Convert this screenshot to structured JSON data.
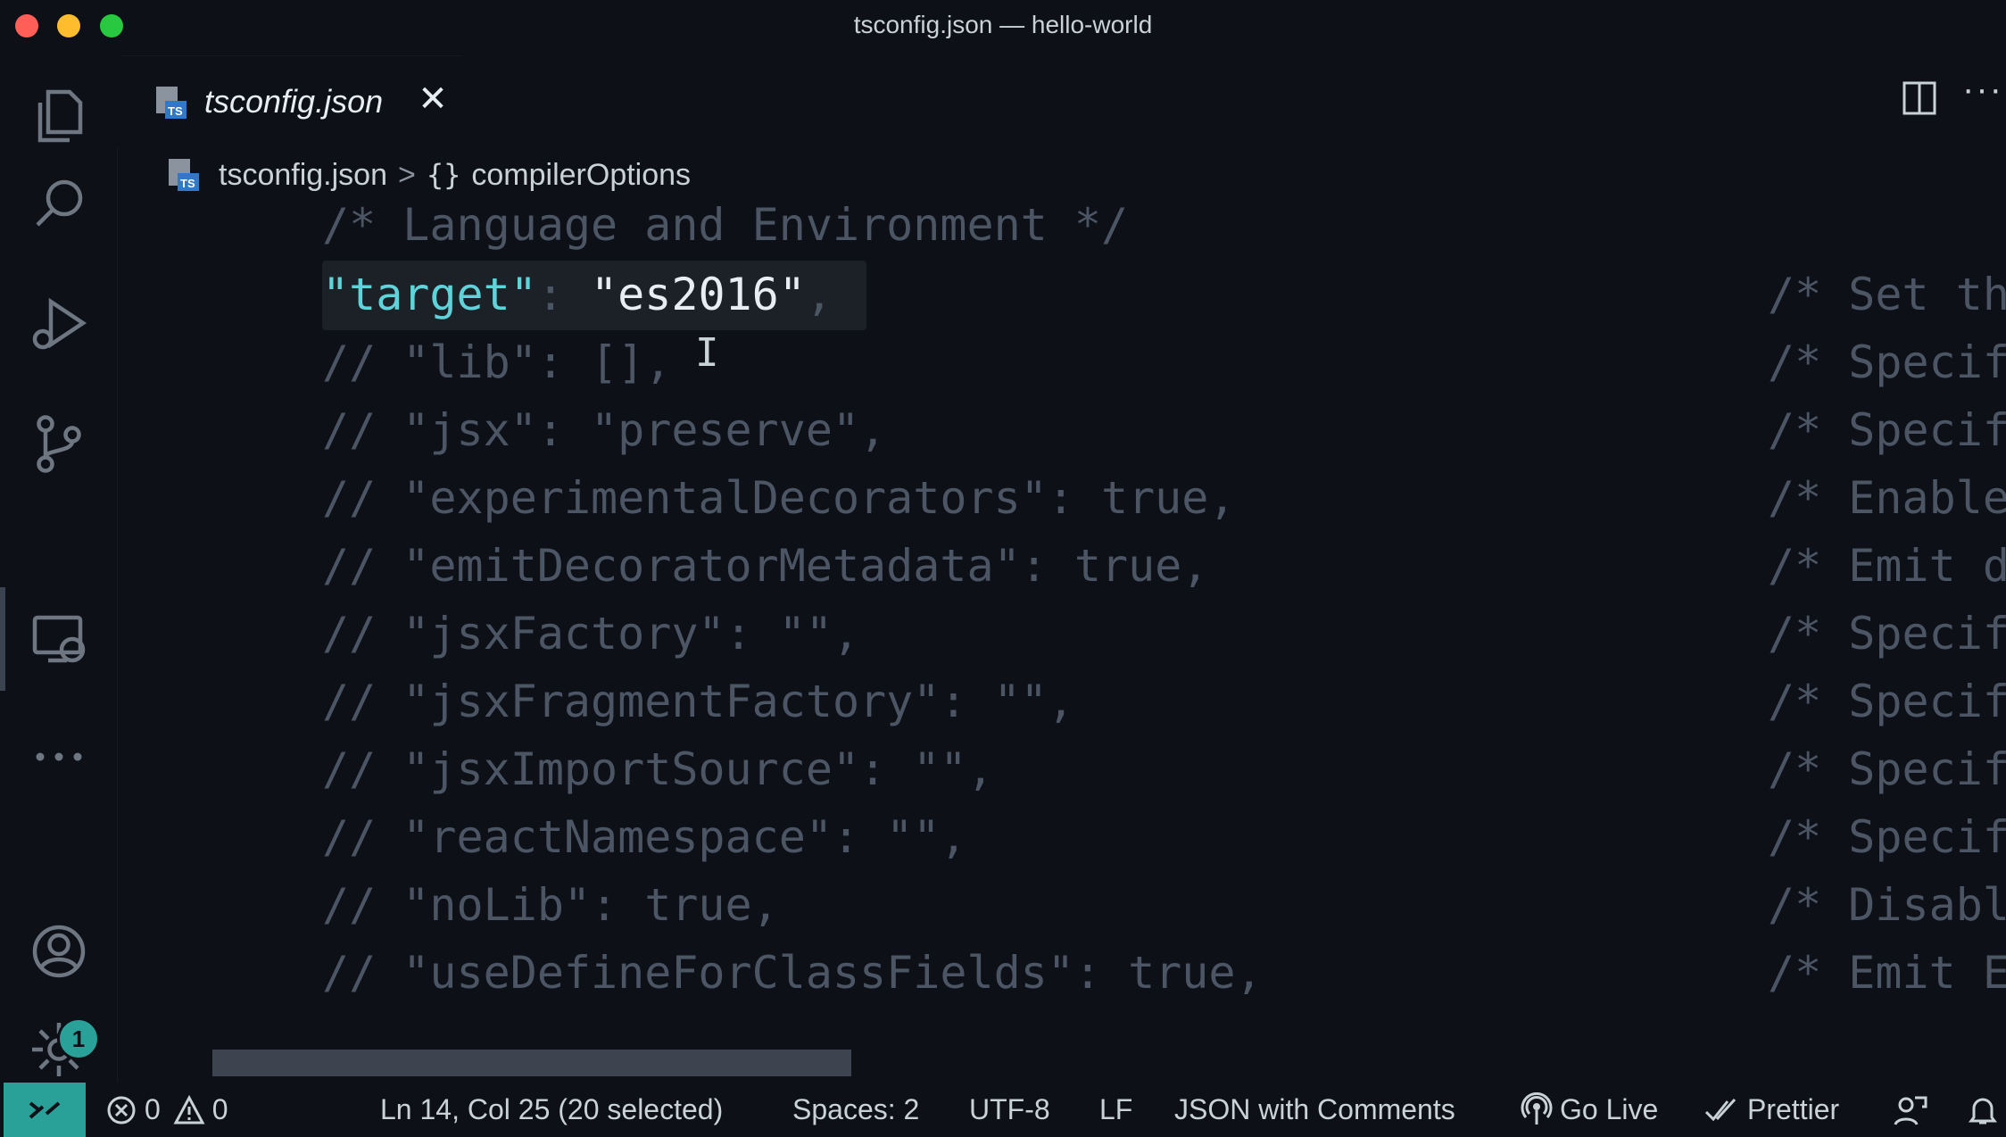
{
  "window": {
    "title": "tsconfig.json — hello-world"
  },
  "tab": {
    "label": "tsconfig.json",
    "close_glyph": "✕"
  },
  "breadcrumb": {
    "file": "tsconfig.json",
    "separator": ">",
    "brace": "{}",
    "section": "compilerOptions"
  },
  "editor": {
    "comment_header": "/* Language and Environment */",
    "target_line": {
      "key": "\"target\"",
      "colon": ":",
      "value": "\"es2016\"",
      "comma": ","
    },
    "lines": [
      "// \"lib\": [],",
      "// \"jsx\": \"preserve\",",
      "// \"experimentalDecorators\": true,",
      "// \"emitDecoratorMetadata\": true,",
      "// \"jsxFactory\": \"\",",
      "// \"jsxFragmentFactory\": \"\",",
      "// \"jsxImportSource\": \"\",",
      "// \"reactNamespace\": \"\",",
      "// \"noLib\": true,",
      "// \"useDefineForClassFields\": true,"
    ],
    "right_comments": [
      "/* Set th",
      "/* Specif",
      "/* Specif",
      "/* Enable",
      "/* Emit d",
      "/* Specif",
      "/* Specif",
      "/* Specif",
      "/* Specif",
      "/* Disabl",
      "/* Emit E"
    ]
  },
  "activity": {
    "settings_badge": "1"
  },
  "status": {
    "errors": "0",
    "warnings": "0",
    "position": "Ln 14, Col 25 (20 selected)",
    "spaces": "Spaces: 2",
    "encoding": "UTF-8",
    "eol": "LF",
    "language": "JSON with Comments",
    "golive": "Go Live",
    "prettier": "Prettier"
  },
  "colors": {
    "accent": "#2aa198",
    "key": "#5fd3d9",
    "comment": "#4b5563",
    "background": "#0d1117"
  }
}
